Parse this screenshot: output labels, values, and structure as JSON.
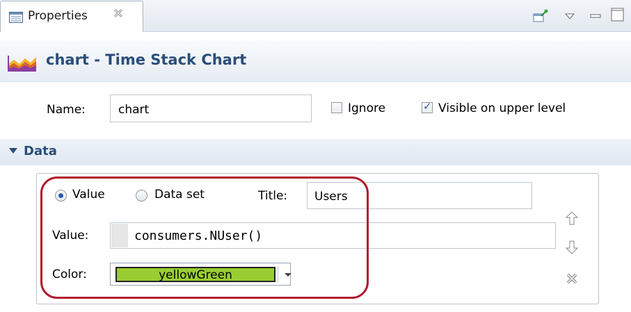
{
  "tab": {
    "label": "Properties",
    "icon": "properties-icon",
    "close_icon": "close-icon"
  },
  "toolbar": {
    "icons": [
      "pin-icon",
      "view-menu-icon",
      "minimize-icon",
      "maximize-icon"
    ]
  },
  "header": {
    "title": "chart - Time Stack Chart",
    "icon": "time-stack-chart-icon"
  },
  "general": {
    "name_label": "Name:",
    "name_value": "chart",
    "ignore": {
      "label": "Ignore",
      "checked": false
    },
    "visible_upper": {
      "label": "Visible on upper level",
      "checked": true
    }
  },
  "data_section": {
    "title": "Data",
    "expanded": true,
    "value_radio": {
      "label": "Value",
      "selected": true
    },
    "dataset_radio": {
      "label": "Data set",
      "selected": false
    },
    "title_label": "Title:",
    "title_value": "Users",
    "value_label": "Value:",
    "value_expression": "consumers.NUser()",
    "color_label": "Color:",
    "color_value": "yellowGreen",
    "color_hex": "#9acd32",
    "side_buttons": [
      "move-up-icon",
      "move-down-icon",
      "remove-icon"
    ]
  },
  "highlight_color": "#b2192d"
}
